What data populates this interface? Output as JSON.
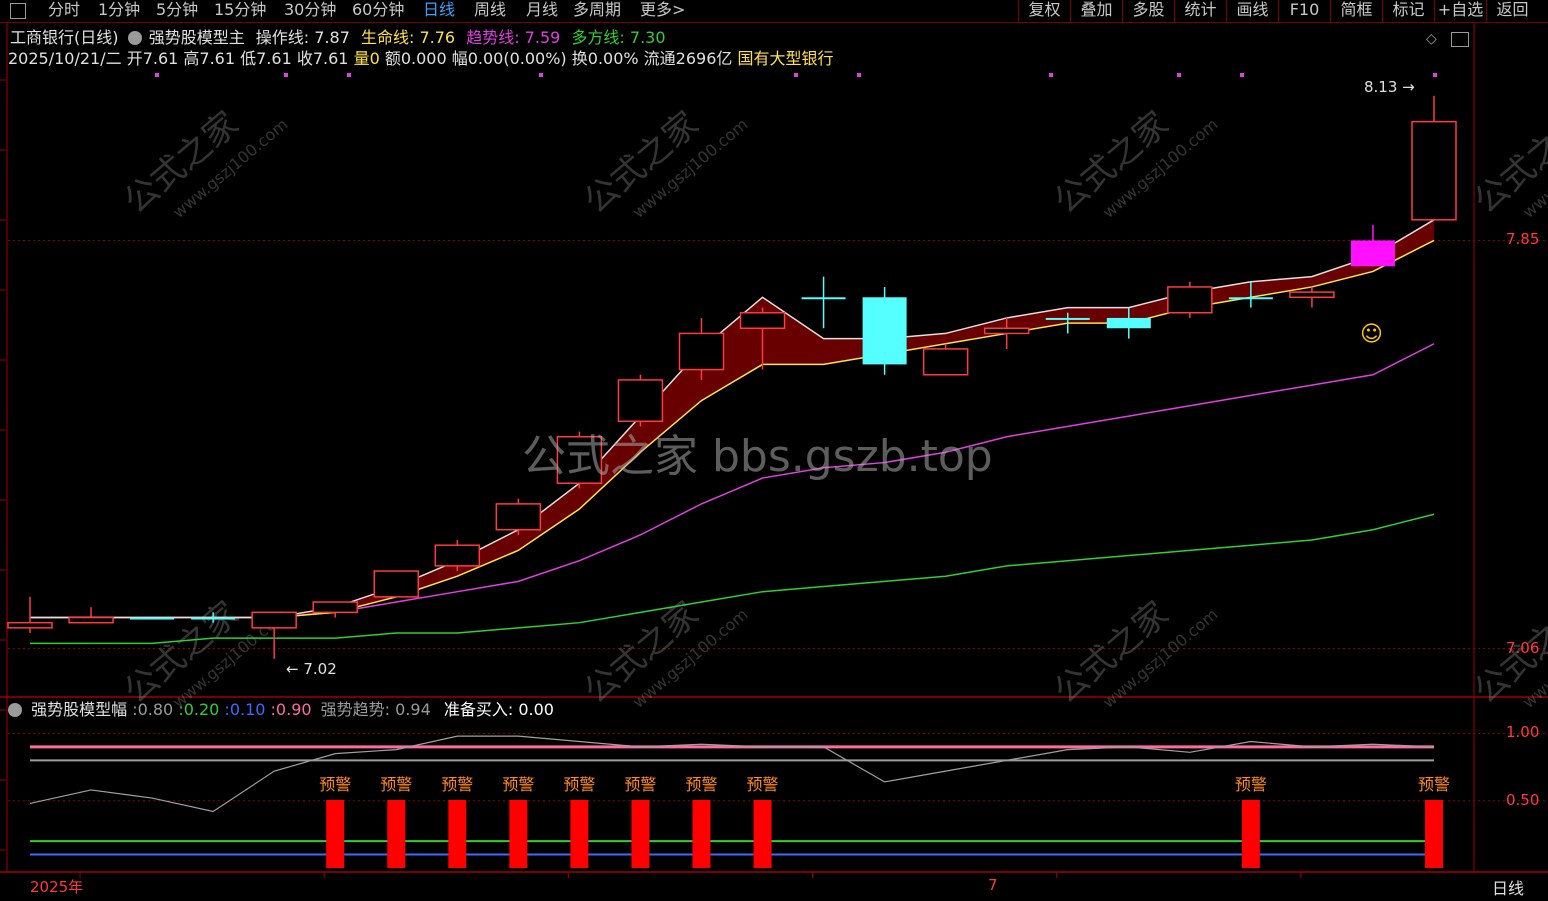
{
  "topbar": {
    "periods": [
      "分时",
      "1分钟",
      "5分钟",
      "15分钟",
      "30分钟",
      "60分钟",
      "日线",
      "周线",
      "月线",
      "多周期",
      "更多>"
    ],
    "active": "日线",
    "right": [
      "复权",
      "叠加",
      "多股",
      "统计",
      "画线",
      "F10",
      "简框",
      "标记",
      "+自选",
      "返回"
    ]
  },
  "header": {
    "stock": "工商银行(日线)",
    "indicator": "强势股模型主",
    "op_line": "操作线: 7.87",
    "life_line": "生命线: 7.76",
    "trend_line": "趋势线: 7.59",
    "multi_line": "多方线: 7.30",
    "bar_info": "2025/10/21/二 开7.61 高7.61 低7.61 收7.61",
    "vol": "量0",
    "amount": "额0.000 幅0.00(0.00%) 换0.00% 流通2696亿",
    "sector": "国有大型银行"
  },
  "sub_header": {
    "name": "强势股模型幅",
    "v1": ":0.80",
    "v2": ":0.20",
    "v3": ":0.10",
    "v4": ":0.90",
    "trend": "强势趋势: 0.94",
    "ready": "准备买入: 0.00"
  },
  "bottom": {
    "year": "2025年",
    "month": "7",
    "period": "日线"
  },
  "watermark": {
    "center": "公式之家 bbs.gszb.top",
    "repeat": "公式之家",
    "repeat_url": "www.gszj100.com"
  },
  "colors": {
    "up": "#ff3b3b",
    "down": "#55ffff",
    "op": "#e0e0e0",
    "life": "#ffe14a",
    "trend": "#e040e0",
    "multi": "#30d030",
    "band": "#6e0000",
    "warn": "#ff0000",
    "warn_text": "#ff8a1e"
  },
  "chart_data": {
    "type": "candlestick",
    "y_labels": [
      "7.85",
      "7.06"
    ],
    "y_label_values": [
      7.85,
      7.06
    ],
    "ylim": [
      6.97,
      8.18
    ],
    "max_label": "8.13",
    "min_label": "7.02",
    "candles": [
      {
        "o": 7.1,
        "h": 7.16,
        "l": 7.09,
        "c": 7.11
      },
      {
        "o": 7.11,
        "h": 7.14,
        "l": 7.11,
        "c": 7.12
      },
      {
        "o": 7.12,
        "h": 7.12,
        "l": 7.12,
        "c": 7.12,
        "d": true
      },
      {
        "o": 7.12,
        "h": 7.13,
        "l": 7.11,
        "c": 7.12,
        "d": true
      },
      {
        "o": 7.1,
        "h": 7.13,
        "l": 7.04,
        "c": 7.13
      },
      {
        "o": 7.13,
        "h": 7.15,
        "l": 7.12,
        "c": 7.15
      },
      {
        "o": 7.16,
        "h": 7.21,
        "l": 7.16,
        "c": 7.21
      },
      {
        "o": 7.22,
        "h": 7.27,
        "l": 7.21,
        "c": 7.26
      },
      {
        "o": 7.29,
        "h": 7.35,
        "l": 7.28,
        "c": 7.34
      },
      {
        "o": 7.38,
        "h": 7.48,
        "l": 7.37,
        "c": 7.47
      },
      {
        "o": 7.5,
        "h": 7.59,
        "l": 7.49,
        "c": 7.58
      },
      {
        "o": 7.6,
        "h": 7.7,
        "l": 7.58,
        "c": 7.67
      },
      {
        "o": 7.68,
        "h": 7.72,
        "l": 7.6,
        "c": 7.71
      },
      {
        "o": 7.74,
        "h": 7.78,
        "l": 7.68,
        "c": 7.74,
        "d": true
      },
      {
        "o": 7.74,
        "h": 7.76,
        "l": 7.59,
        "c": 7.61,
        "d": true
      },
      {
        "o": 7.59,
        "h": 7.65,
        "l": 7.59,
        "c": 7.64
      },
      {
        "o": 7.67,
        "h": 7.7,
        "l": 7.64,
        "c": 7.68
      },
      {
        "o": 7.7,
        "h": 7.71,
        "l": 7.67,
        "c": 7.7,
        "d": true
      },
      {
        "o": 7.7,
        "h": 7.72,
        "l": 7.66,
        "c": 7.68,
        "d": true
      },
      {
        "o": 7.71,
        "h": 7.77,
        "l": 7.7,
        "c": 7.76
      },
      {
        "o": 7.74,
        "h": 7.77,
        "l": 7.72,
        "c": 7.74,
        "d": true
      },
      {
        "o": 7.74,
        "h": 7.76,
        "l": 7.72,
        "c": 7.75
      },
      {
        "o": 7.8,
        "h": 7.88,
        "l": 7.8,
        "c": 7.85,
        "d": true
      },
      {
        "o": 7.89,
        "h": 8.13,
        "l": 7.89,
        "c": 8.08
      }
    ],
    "op_line": [
      7.12,
      7.12,
      7.12,
      7.12,
      7.12,
      7.14,
      7.18,
      7.23,
      7.29,
      7.38,
      7.51,
      7.64,
      7.74,
      7.66,
      7.66,
      7.67,
      7.7,
      7.72,
      7.72,
      7.75,
      7.77,
      7.78,
      7.82,
      7.89
    ],
    "life_line": [
      7.12,
      7.12,
      7.12,
      7.12,
      7.12,
      7.13,
      7.16,
      7.2,
      7.25,
      7.33,
      7.44,
      7.54,
      7.61,
      7.61,
      7.63,
      7.65,
      7.67,
      7.69,
      7.69,
      7.72,
      7.74,
      7.76,
      7.79,
      7.85
    ],
    "trend_line": [
      7.12,
      7.12,
      7.12,
      7.12,
      7.12,
      7.13,
      7.15,
      7.17,
      7.19,
      7.23,
      7.28,
      7.34,
      7.39,
      7.41,
      7.42,
      7.44,
      7.47,
      7.49,
      7.51,
      7.53,
      7.55,
      7.57,
      7.59,
      7.65
    ],
    "multi_line": [
      7.07,
      7.07,
      7.07,
      7.08,
      7.08,
      7.08,
      7.09,
      7.09,
      7.1,
      7.11,
      7.13,
      7.15,
      7.17,
      7.18,
      7.19,
      7.2,
      7.22,
      7.23,
      7.24,
      7.25,
      7.26,
      7.27,
      7.29,
      7.32
    ],
    "sub": {
      "ylim": [
        0,
        1.1
      ],
      "y_labels": [
        "1.00",
        "0.50"
      ],
      "y_label_values": [
        1.0,
        0.5
      ],
      "levels": [
        0.8,
        0.2,
        0.1,
        0.9
      ],
      "trend": [
        0.48,
        0.58,
        0.52,
        0.42,
        0.72,
        0.85,
        0.88,
        0.98,
        0.98,
        0.94,
        0.9,
        0.92,
        0.9,
        0.9,
        0.64,
        0.72,
        0.8,
        0.88,
        0.9,
        0.86,
        0.94,
        0.9,
        0.92,
        0.9
      ],
      "warn_label": "预警",
      "warn_index": [
        5,
        6,
        7,
        8,
        9,
        10,
        11,
        12,
        20,
        23
      ]
    }
  }
}
